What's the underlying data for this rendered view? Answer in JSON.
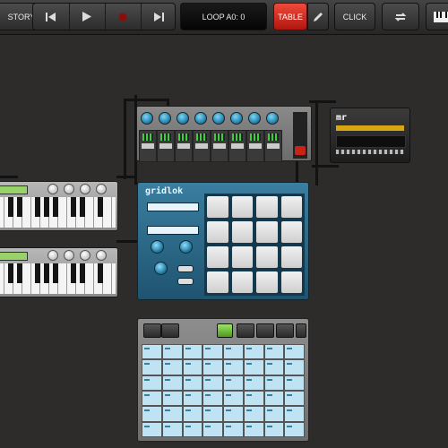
{
  "toolbar": {
    "history_label": "STORY",
    "loop_label": "LOOP A0: 0",
    "table_label": "TABLE",
    "click_label": "CLICK"
  },
  "icons": {
    "skip_back": "skip-back-icon",
    "play": "play-icon",
    "record": "record-icon",
    "skip_forward": "skip-forward-icon",
    "pencil": "pencil-icon",
    "cycle": "cycle-icon",
    "keyboard": "keyboard-icon"
  },
  "devices": {
    "mr_logo": "mr",
    "gridlok_logo": "gridlok"
  },
  "colors": {
    "table_active": "#d7281c",
    "gridlok_body": "#2a6a8a",
    "launcher_cell": "#bfe3f2"
  }
}
